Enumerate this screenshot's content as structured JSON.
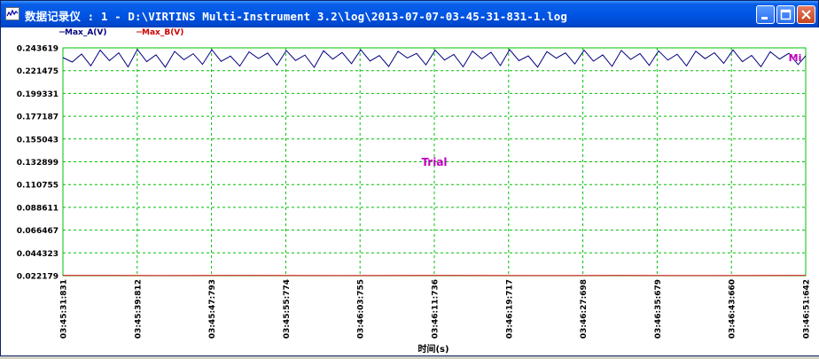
{
  "window": {
    "title": "数据记录仪 : 1 - D:\\VIRTINS Multi-Instrument 3.2\\log\\2013-07-07-03-45-31-831-1.log",
    "icon": "chart-log-icon",
    "buttons": [
      "minimize-icon",
      "maximize-icon",
      "close-icon"
    ]
  },
  "colors": {
    "series_a": "#00007f",
    "series_b": "#cc0000",
    "grid": "#00c000",
    "watermark": "#c000c0",
    "axis_text": "#000000"
  },
  "chart_data": {
    "type": "line",
    "xlabel": "时间(s)",
    "ylabel": "",
    "watermark": "Trial",
    "corner_label": "Mi",
    "legend": {
      "placement": "top-left",
      "entries": [
        {
          "name": "Max_A(V)",
          "color": "#00007f"
        },
        {
          "name": "Max_B(V)",
          "color": "#cc0000"
        }
      ]
    },
    "grid": true,
    "yticks": [
      "0.243619",
      "0.221475",
      "0.199331",
      "0.177187",
      "0.155043",
      "0.132899",
      "0.110755",
      "0.088611",
      "0.066467",
      "0.044323",
      "0.022179"
    ],
    "ylim": [
      0.022179,
      0.243619
    ],
    "xticks": [
      "03:45:31:831",
      "03:45:39:812",
      "03:45:47:793",
      "03:45:55:774",
      "03:46:03:755",
      "03:46:11:736",
      "03:46:19:717",
      "03:46:27:698",
      "03:46:35:679",
      "03:46:43:660",
      "03:46:51:642"
    ],
    "xlim_seconds": [
      0,
      79.811
    ],
    "series": [
      {
        "name": "Max_A(V)",
        "color": "#00007f",
        "x": [
          0,
          1,
          2,
          3,
          4,
          5,
          6,
          7,
          8,
          9,
          10,
          11,
          12,
          13,
          14,
          15,
          16,
          17,
          18,
          19,
          20,
          21,
          22,
          23,
          24,
          25,
          26,
          27,
          28,
          29,
          30,
          31,
          32,
          33,
          34,
          35,
          36,
          37,
          38,
          39,
          40,
          41,
          42,
          43,
          44,
          45,
          46,
          47,
          48,
          49,
          50,
          51,
          52,
          53,
          54,
          55,
          56,
          57,
          58,
          59,
          60,
          61,
          62,
          63,
          64,
          65,
          66,
          67,
          68,
          69,
          70,
          71,
          72,
          73,
          74,
          75,
          76,
          77,
          78,
          79,
          79.811
        ],
        "y": [
          0.2341,
          0.2298,
          0.2376,
          0.2262,
          0.2415,
          0.2312,
          0.2388,
          0.2251,
          0.2421,
          0.2303,
          0.2369,
          0.2248,
          0.2402,
          0.2321,
          0.2379,
          0.2276,
          0.2418,
          0.2305,
          0.2356,
          0.2259,
          0.2397,
          0.2333,
          0.2386,
          0.2268,
          0.241,
          0.2314,
          0.2366,
          0.2247,
          0.2409,
          0.2327,
          0.2391,
          0.2283,
          0.2417,
          0.2309,
          0.2361,
          0.2255,
          0.2403,
          0.2338,
          0.2382,
          0.2271,
          0.2413,
          0.2318,
          0.2372,
          0.2252,
          0.2405,
          0.2329,
          0.2393,
          0.2264,
          0.2419,
          0.2311,
          0.2359,
          0.2249,
          0.24,
          0.2336,
          0.2387,
          0.2279,
          0.2414,
          0.2307,
          0.2368,
          0.2256,
          0.2411,
          0.2324,
          0.2381,
          0.2266,
          0.2407,
          0.2317,
          0.2374,
          0.2261,
          0.2404,
          0.2331,
          0.2389,
          0.2285,
          0.2416,
          0.2302,
          0.2363,
          0.2253,
          0.2398,
          0.2328,
          0.2384,
          0.2273,
          0.236
        ]
      },
      {
        "name": "Max_B(V)",
        "color": "#cc0000",
        "x": [
          0,
          10,
          20,
          30,
          40,
          50,
          60,
          70,
          79.811
        ],
        "y": [
          0.0224,
          0.0223,
          0.0224,
          0.0223,
          0.0224,
          0.0223,
          0.0224,
          0.0223,
          0.0224
        ]
      }
    ]
  }
}
